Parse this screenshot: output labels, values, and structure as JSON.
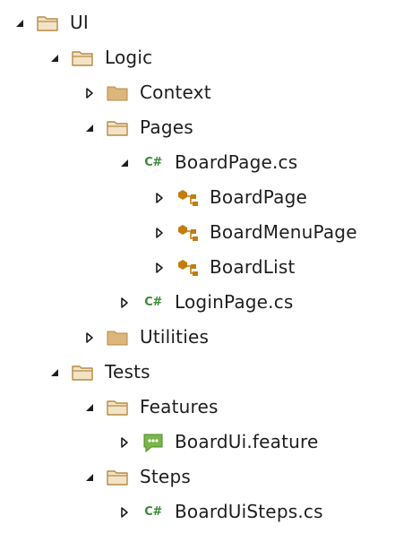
{
  "colors": {
    "folder_fill": "#dcb67a",
    "folder_open_fill": "#f3e3c6",
    "folder_stroke": "#b58b45",
    "csharp_green": "#388a34",
    "class_orange": "#c27d0e",
    "feature_green": "#7ab648",
    "expander_gray": "#1e1e1e"
  },
  "tree": [
    {
      "label": "UI",
      "icon": "folder-open-icon",
      "state": "expanded",
      "level": 0
    },
    {
      "label": "Logic",
      "icon": "folder-open-icon",
      "state": "expanded",
      "level": 1
    },
    {
      "label": "Context",
      "icon": "folder-closed-icon",
      "state": "collapsed",
      "level": 2
    },
    {
      "label": "Pages",
      "icon": "folder-open-icon",
      "state": "expanded",
      "level": 2
    },
    {
      "label": "BoardPage.cs",
      "icon": "csharp-file-icon",
      "state": "expanded",
      "level": 3
    },
    {
      "label": "BoardPage",
      "icon": "class-icon",
      "state": "collapsed",
      "level": 4
    },
    {
      "label": "BoardMenuPage",
      "icon": "class-icon",
      "state": "collapsed",
      "level": 4
    },
    {
      "label": "BoardList",
      "icon": "class-icon",
      "state": "collapsed",
      "level": 4
    },
    {
      "label": "LoginPage.cs",
      "icon": "csharp-file-icon",
      "state": "collapsed",
      "level": 3
    },
    {
      "label": "Utilities",
      "icon": "folder-closed-icon",
      "state": "collapsed",
      "level": 2
    },
    {
      "label": "Tests",
      "icon": "folder-open-icon",
      "state": "expanded",
      "level": 1
    },
    {
      "label": "Features",
      "icon": "folder-open-icon",
      "state": "expanded",
      "level": 2
    },
    {
      "label": "BoardUi.feature",
      "icon": "feature-file-icon",
      "state": "collapsed",
      "level": 3
    },
    {
      "label": "Steps",
      "icon": "folder-open-icon",
      "state": "expanded",
      "level": 2
    },
    {
      "label": "BoardUiSteps.cs",
      "icon": "csharp-file-icon",
      "state": "collapsed",
      "level": 3
    }
  ],
  "csharp_glyph": "C#"
}
